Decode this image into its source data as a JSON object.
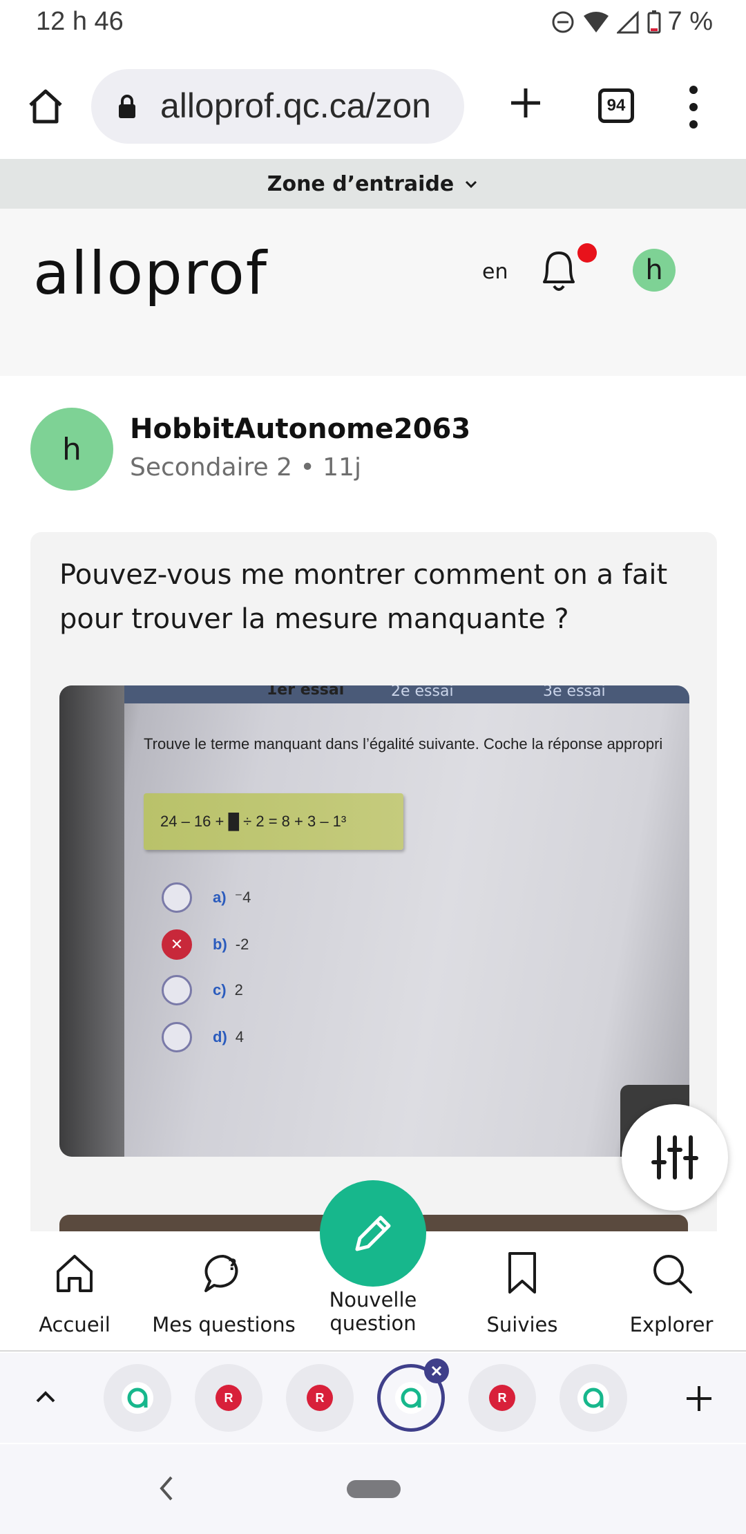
{
  "status_bar": {
    "time": "12 h 46",
    "battery": "7 %"
  },
  "browser": {
    "url": "alloprof.qc.ca/zon",
    "tab_count": "94"
  },
  "zone_bar": {
    "label": "Zone d’entraide"
  },
  "header": {
    "logo": "alloprof",
    "language": "en",
    "avatar_initial": "h"
  },
  "post": {
    "author_initial": "h",
    "author_name": "HobbitAutonome2063",
    "author_meta": "Secondaire 2 • 11j",
    "question": "Pouvez-vous me montrer comment on a fait pour trouver la mesure manquante ?"
  },
  "photo": {
    "tabs": [
      "1er essai",
      "2e essai",
      "3e essai"
    ],
    "instruction": "Trouve le terme manquant dans l’égalité suivante. Coche la réponse appropri",
    "equation": "24 – 16 + █ ÷ 2 = 8 + 3 – 1³",
    "options": [
      {
        "letter": "a)",
        "value": "⁻4",
        "state": "empty"
      },
      {
        "letter": "b)",
        "value": "-2",
        "state": "wrong"
      },
      {
        "letter": "c)",
        "value": "2",
        "state": "empty"
      },
      {
        "letter": "d)",
        "value": "4",
        "state": "empty"
      }
    ]
  },
  "bottom_nav": {
    "items": [
      {
        "label": "Accueil",
        "icon": "home-icon"
      },
      {
        "label": "Mes questions",
        "icon": "question-bubble-icon"
      },
      {
        "label": "Nouvelle question",
        "icon": "pencil-icon"
      },
      {
        "label": "Suivies",
        "icon": "bookmark-icon"
      },
      {
        "label": "Explorer",
        "icon": "search-icon"
      }
    ]
  },
  "tab_strip": {
    "tabs": [
      "alloprof",
      "R",
      "R",
      "alloprof",
      "R",
      "alloprof"
    ]
  },
  "colors": {
    "accent": "#17b78c",
    "avatar": "#7ed295",
    "notification": "#e8121b",
    "tab_active": "#3f3f8a"
  }
}
